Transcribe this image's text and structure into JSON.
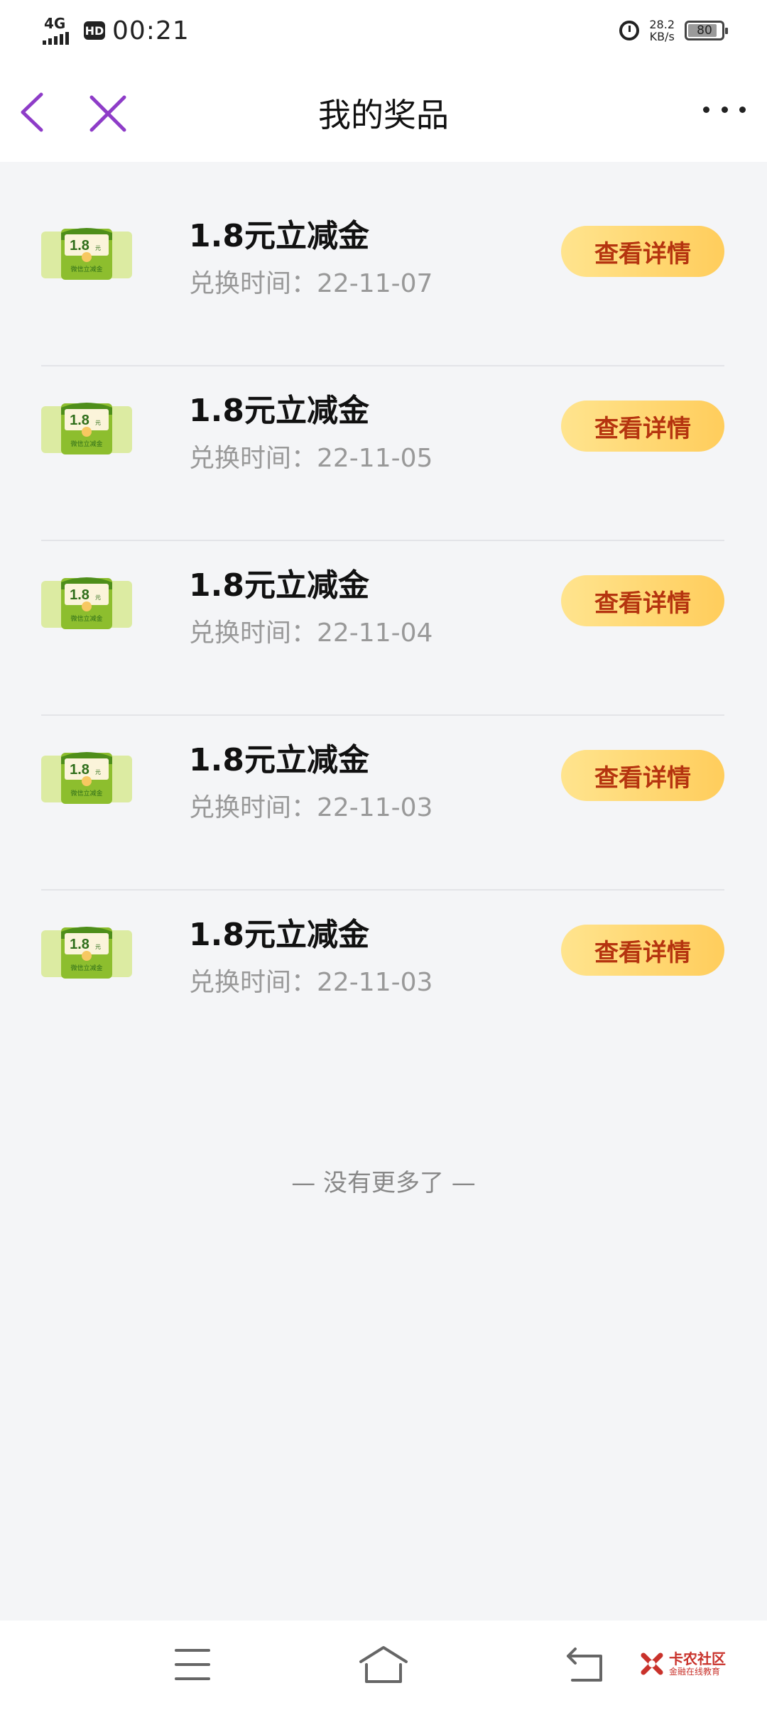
{
  "status_bar": {
    "network": "4G",
    "hd": "HD",
    "time": "00:21",
    "net_speed_value": "28.2",
    "net_speed_unit": "KB/s",
    "battery_level": "80",
    "icons": [
      "signal-icon",
      "hd-icon",
      "alarm-icon",
      "battery-icon"
    ]
  },
  "nav": {
    "title": "我的奖品",
    "icons": [
      "back-icon",
      "close-icon",
      "more-icon"
    ],
    "accent_color": "#8E3CC8"
  },
  "prizes": [
    {
      "name": "1.8元立减金",
      "time": "兑换时间：22-11-07",
      "button": "查看详情",
      "badge_amount": "1.8",
      "badge_unit": "元",
      "badge_caption": "微信立减金"
    },
    {
      "name": "1.8元立减金",
      "time": "兑换时间：22-11-05",
      "button": "查看详情",
      "badge_amount": "1.8",
      "badge_unit": "元",
      "badge_caption": "微信立减金"
    },
    {
      "name": "1.8元立减金",
      "time": "兑换时间：22-11-04",
      "button": "查看详情",
      "badge_amount": "1.8",
      "badge_unit": "元",
      "badge_caption": "微信立减金"
    },
    {
      "name": "1.8元立减金",
      "time": "兑换时间：22-11-03",
      "button": "查看详情",
      "badge_amount": "1.8",
      "badge_unit": "元",
      "badge_caption": "微信立减金"
    },
    {
      "name": "1.8元立减金",
      "time": "兑换时间：22-11-03",
      "button": "查看详情",
      "badge_amount": "1.8",
      "badge_unit": "元",
      "badge_caption": "微信立减金"
    }
  ],
  "list_end_text": "— 没有更多了 —",
  "bottom_bar": {
    "icons": [
      "menu-icon",
      "home-icon",
      "back-icon"
    ],
    "logo_text": "卡农社区",
    "logo_subtext": "金融在线教育"
  },
  "colors": {
    "button_gradient_start": "#FFE48E",
    "button_gradient_end": "#FFCD5C",
    "button_text": "#B5340F",
    "page_background": "#F4F5F7"
  }
}
